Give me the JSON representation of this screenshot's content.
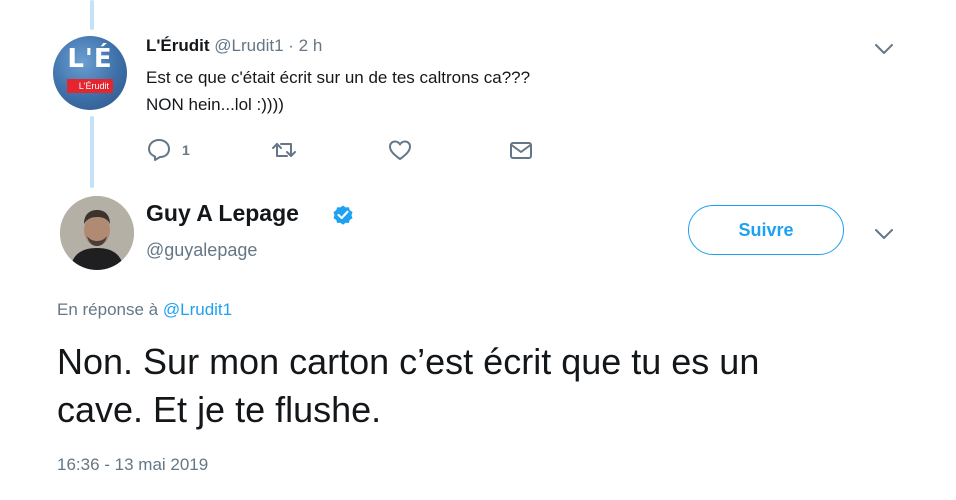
{
  "reply_tweet": {
    "author_name": "L'Érudit",
    "author_handle": "@Lrudit1",
    "separator": "·",
    "time": "2 h",
    "avatar_text": "L'É",
    "avatar_subtext": "L'Érudit",
    "text_lines": [
      "Est ce que c'était écrit sur un de tes caltrons ca???",
      "NON hein...lol :))))"
    ],
    "reply_count": "1",
    "icons": [
      "reply-icon",
      "retweet-icon",
      "like-icon",
      "direct-message-icon",
      "chevron-down-icon"
    ]
  },
  "main_tweet": {
    "author_name": "Guy A Lepage",
    "verified": true,
    "author_handle": "@guyalepage",
    "follow_label": "Suivre",
    "in_reply_prefix": "En réponse à",
    "in_reply_mention": "@Lrudit1",
    "text_lines": [
      "Non. Sur mon carton c’est écrit que tu es un",
      "cave. Et je te flushe."
    ],
    "timestamp": "16:36 - 13 mai 2019"
  },
  "colors": {
    "accent": "#1da1f2",
    "muted": "#657786",
    "text": "#14171a",
    "thread_line": "#c4e2f7"
  }
}
